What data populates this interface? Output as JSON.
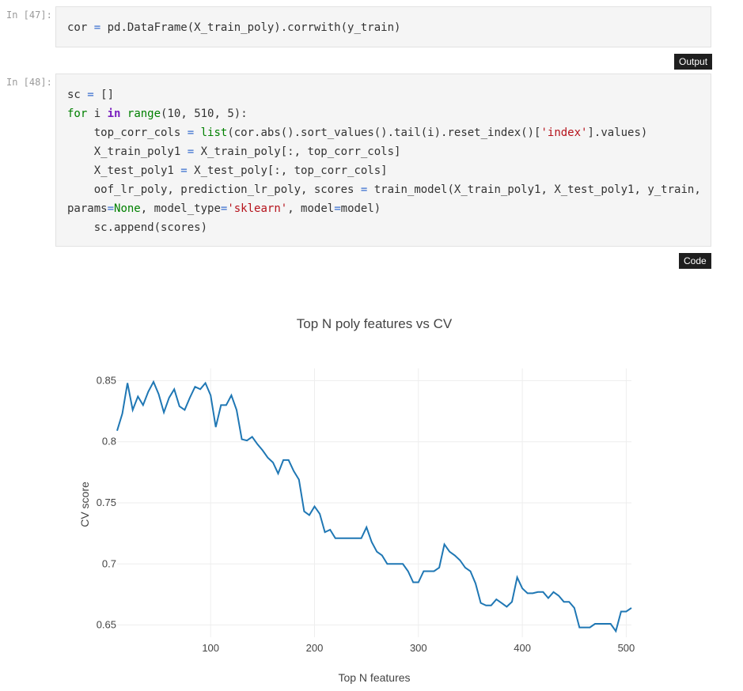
{
  "cells": [
    {
      "prompt": "In [47]:",
      "lines": [
        [
          [
            "t",
            "cor "
          ],
          [
            "op",
            "="
          ],
          [
            "t",
            " pd.DataFrame(X_train_poly).corrwith(y_train)"
          ]
        ]
      ]
    },
    {
      "prompt": "In [48]:",
      "lines": [
        [
          [
            "t",
            "sc "
          ],
          [
            "op",
            "="
          ],
          [
            "t",
            " []"
          ]
        ],
        [
          [
            "kw",
            "for"
          ],
          [
            "t",
            " i "
          ],
          [
            "kwb",
            "in"
          ],
          [
            "t",
            " "
          ],
          [
            "kw",
            "range"
          ],
          [
            "t",
            "(10, 510, 5):"
          ]
        ],
        [
          [
            "t",
            "    top_corr_cols "
          ],
          [
            "op",
            "="
          ],
          [
            "t",
            " "
          ],
          [
            "kw",
            "list"
          ],
          [
            "t",
            "(cor.abs().sort_values().tail(i).reset_index()["
          ],
          [
            "str",
            "'index'"
          ],
          [
            "t",
            "].values)"
          ]
        ],
        [
          [
            "t",
            "    X_train_poly1 "
          ],
          [
            "op",
            "="
          ],
          [
            "t",
            " X_train_poly[:, top_corr_cols]"
          ]
        ],
        [
          [
            "t",
            "    X_test_poly1 "
          ],
          [
            "op",
            "="
          ],
          [
            "t",
            " X_test_poly[:, top_corr_cols]"
          ]
        ],
        [
          [
            "t",
            "    oof_lr_poly, prediction_lr_poly, scores "
          ],
          [
            "op",
            "="
          ],
          [
            "t",
            " train_model(X_train_poly1, X_test_poly1, y_train,"
          ]
        ],
        [
          [
            "t",
            "params"
          ],
          [
            "op",
            "="
          ],
          [
            "none",
            "None"
          ],
          [
            "t",
            ", model_type"
          ],
          [
            "op",
            "="
          ],
          [
            "str",
            "'sklearn'"
          ],
          [
            "t",
            ", model"
          ],
          [
            "op",
            "="
          ],
          [
            "t",
            "model)"
          ]
        ],
        [
          [
            "t",
            "    sc.append(scores)"
          ]
        ]
      ]
    }
  ],
  "badges": {
    "output": "Output",
    "code": "Code"
  },
  "chart_data": {
    "type": "line",
    "title": "Top N poly features vs CV",
    "xlabel": "Top N features",
    "ylabel": "CV score",
    "xlim": [
      10,
      505
    ],
    "ylim": [
      0.64,
      0.86
    ],
    "xticks": [
      100,
      200,
      300,
      400,
      500
    ],
    "yticks": [
      0.65,
      0.7,
      0.75,
      0.8,
      0.85
    ],
    "ytick_labels": [
      "0.65",
      "0.7",
      "0.75",
      "0.8",
      "0.85"
    ],
    "grid": true,
    "color": "#1f77b4",
    "series": [
      {
        "x": [
          10,
          15,
          20,
          25,
          30,
          35,
          40,
          45,
          50,
          55,
          60,
          65,
          70,
          75,
          80,
          85,
          90,
          95,
          100,
          105,
          110,
          115,
          120,
          125,
          130,
          135,
          140,
          145,
          150,
          155,
          160,
          165,
          170,
          175,
          180,
          185,
          190,
          195,
          200,
          205,
          210,
          215,
          220,
          225,
          230,
          235,
          240,
          245,
          250,
          255,
          260,
          265,
          270,
          275,
          280,
          285,
          290,
          295,
          300,
          305,
          310,
          315,
          320,
          325,
          330,
          335,
          340,
          345,
          350,
          355,
          360,
          365,
          370,
          375,
          380,
          385,
          390,
          395,
          400,
          405,
          410,
          415,
          420,
          425,
          430,
          435,
          440,
          445,
          450,
          455,
          460,
          465,
          470,
          475,
          480,
          485,
          490,
          495,
          500,
          505
        ],
        "y": [
          0.809,
          0.823,
          0.848,
          0.826,
          0.837,
          0.83,
          0.841,
          0.849,
          0.839,
          0.824,
          0.836,
          0.843,
          0.829,
          0.826,
          0.836,
          0.845,
          0.843,
          0.848,
          0.838,
          0.812,
          0.83,
          0.83,
          0.838,
          0.826,
          0.802,
          0.801,
          0.804,
          0.798,
          0.793,
          0.787,
          0.783,
          0.774,
          0.785,
          0.785,
          0.776,
          0.769,
          0.743,
          0.74,
          0.747,
          0.741,
          0.726,
          0.728,
          0.721,
          0.721,
          0.721,
          0.721,
          0.721,
          0.721,
          0.73,
          0.718,
          0.71,
          0.707,
          0.7,
          0.7,
          0.7,
          0.7,
          0.694,
          0.685,
          0.685,
          0.694,
          0.694,
          0.694,
          0.697,
          0.716,
          0.71,
          0.707,
          0.703,
          0.697,
          0.694,
          0.684,
          0.668,
          0.666,
          0.666,
          0.671,
          0.668,
          0.665,
          0.669,
          0.689,
          0.68,
          0.676,
          0.676,
          0.677,
          0.677,
          0.672,
          0.677,
          0.674,
          0.669,
          0.669,
          0.664,
          0.648,
          0.648,
          0.648,
          0.651,
          0.651,
          0.651,
          0.651,
          0.645,
          0.661,
          0.661,
          0.664
        ]
      }
    ]
  }
}
